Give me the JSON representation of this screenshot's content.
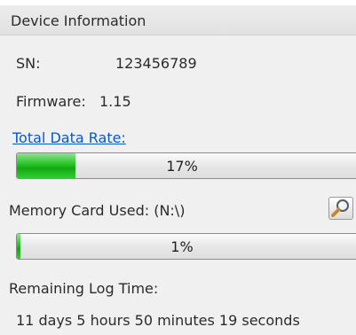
{
  "panel": {
    "title": "Device Information",
    "sn_label": "SN:",
    "sn_value": "123456789",
    "firmware_label": "Firmware:",
    "firmware_value": "1.15",
    "total_rate_link": "Total Data Rate:",
    "total_rate_percent_text": "17%",
    "total_rate_fraction": 0.17,
    "memory_label": "Memory Card Used: (N:\\)",
    "memory_percent_text": "1%",
    "memory_fraction": 0.01,
    "remaining_label": "Remaining Log Time:",
    "remaining_value": "11 days 5 hours 50 minutes 19 seconds"
  },
  "icons": {
    "browse": "magnifier-icon"
  },
  "colors": {
    "progress_fill": "#22c322",
    "link": "#0b57c8",
    "banner_text": "#e00000"
  }
}
